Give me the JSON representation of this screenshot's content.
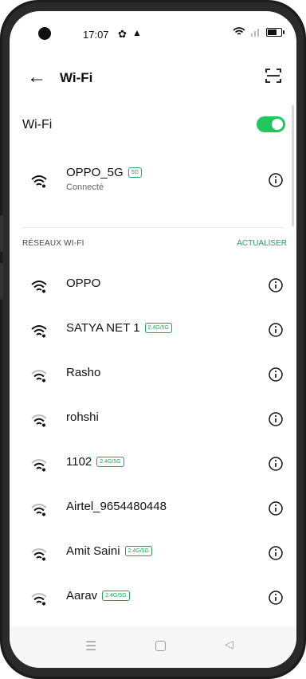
{
  "status_bar": {
    "time": "17:07"
  },
  "header": {
    "title": "Wi-Fi"
  },
  "wifi": {
    "label": "Wi-Fi",
    "enabled": true
  },
  "connected": {
    "name": "OPPO_5G",
    "badge": "5G",
    "status": "Connecté"
  },
  "section": {
    "title": "RÉSEAUX WI-FI",
    "action": "ACTUALISER"
  },
  "networks": [
    {
      "name": "OPPO",
      "badge": ""
    },
    {
      "name": "SATYA NET 1",
      "badge": "2.4G/5G"
    },
    {
      "name": "Rasho",
      "badge": ""
    },
    {
      "name": "rohshi",
      "badge": ""
    },
    {
      "name": "1102",
      "badge": "2.4G/5G"
    },
    {
      "name": "Airtel_9654480448",
      "badge": ""
    },
    {
      "name": "Amit Saini",
      "badge": "2.4G/5G"
    },
    {
      "name": "Aarav",
      "badge": "2.4G/5G"
    }
  ],
  "colors": {
    "accent": "#22c55e",
    "text": "#111111",
    "subtext": "#666666",
    "badge": "#22a35a"
  },
  "icons": [
    "back-arrow-icon",
    "scan-icon",
    "wifi-icon",
    "info-icon",
    "settings-icon",
    "warning-icon",
    "battery-icon"
  ]
}
